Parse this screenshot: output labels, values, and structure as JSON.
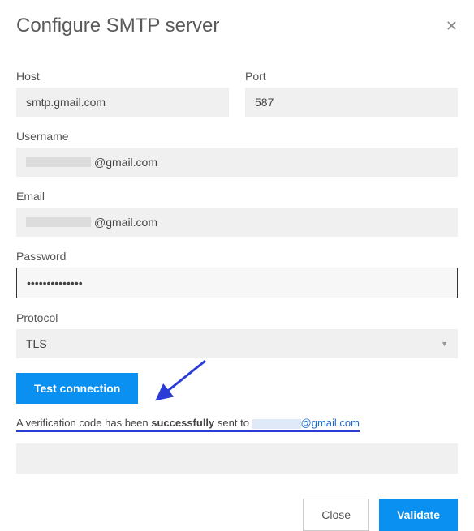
{
  "header": {
    "title": "Configure SMTP server"
  },
  "fields": {
    "host": {
      "label": "Host",
      "value": "smtp.gmail.com"
    },
    "port": {
      "label": "Port",
      "value": "587"
    },
    "username": {
      "label": "Username",
      "value_suffix": "@gmail.com"
    },
    "email": {
      "label": "Email",
      "value_suffix": "@gmail.com"
    },
    "password": {
      "label": "Password",
      "value": "••••••••••••••"
    },
    "protocol": {
      "label": "Protocol",
      "value": "TLS"
    }
  },
  "actions": {
    "test": "Test connection",
    "close": "Close",
    "validate": "Validate"
  },
  "status": {
    "prefix": "A verification code has been ",
    "strong": "successfully",
    "mid": " sent to ",
    "email_suffix": "@gmail.com"
  }
}
